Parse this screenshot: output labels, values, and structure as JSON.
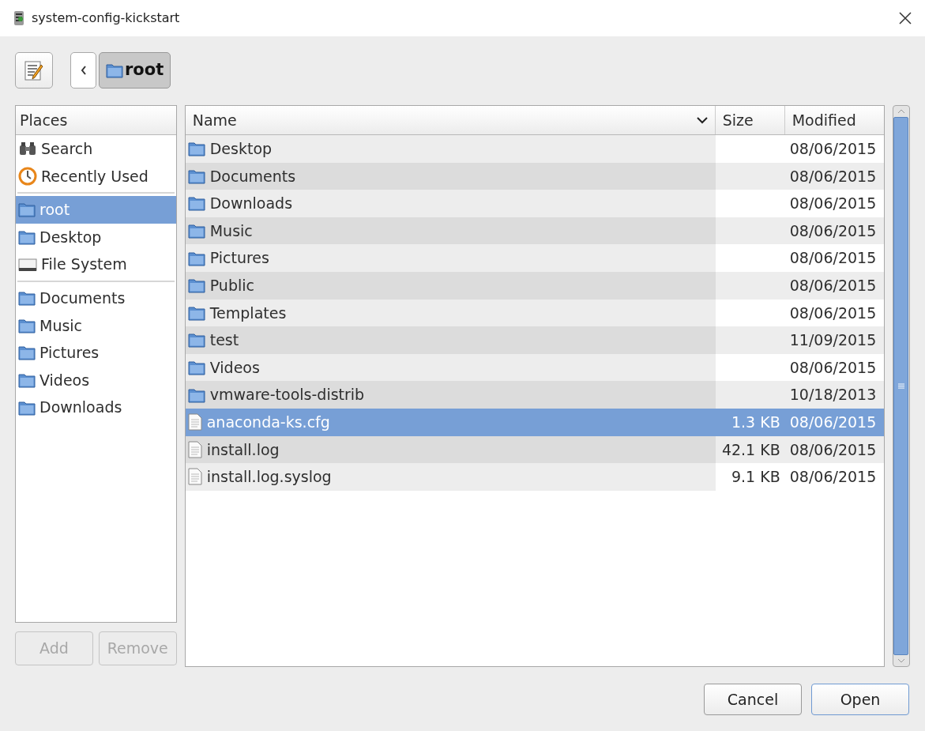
{
  "window": {
    "title": "system-config-kickstart"
  },
  "path_bar": {
    "segments": [
      {
        "label": "root",
        "selected": true
      }
    ]
  },
  "places": {
    "heading": "Places",
    "sections": [
      [
        {
          "label": "Search",
          "kind": "search",
          "selected": false
        },
        {
          "label": "Recently Used",
          "kind": "recent",
          "selected": false
        }
      ],
      [
        {
          "label": "root",
          "kind": "folder",
          "selected": true
        },
        {
          "label": "Desktop",
          "kind": "folder",
          "selected": false
        },
        {
          "label": "File System",
          "kind": "drive",
          "selected": false
        }
      ],
      [
        {
          "label": "Documents",
          "kind": "folder",
          "selected": false
        },
        {
          "label": "Music",
          "kind": "folder",
          "selected": false
        },
        {
          "label": "Pictures",
          "kind": "folder",
          "selected": false
        },
        {
          "label": "Videos",
          "kind": "folder",
          "selected": false
        },
        {
          "label": "Downloads",
          "kind": "folder",
          "selected": false
        }
      ]
    ],
    "buttons": [
      {
        "label": "Add",
        "disabled": true
      },
      {
        "label": "Remove",
        "disabled": true
      }
    ]
  },
  "files": {
    "columns": [
      "Name",
      "Size",
      "Modified"
    ],
    "rows": [
      {
        "name": "Desktop",
        "kind": "folder",
        "size": "",
        "modified": "08/06/2015",
        "selected": false
      },
      {
        "name": "Documents",
        "kind": "folder",
        "size": "",
        "modified": "08/06/2015",
        "selected": false
      },
      {
        "name": "Downloads",
        "kind": "folder",
        "size": "",
        "modified": "08/06/2015",
        "selected": false
      },
      {
        "name": "Music",
        "kind": "folder",
        "size": "",
        "modified": "08/06/2015",
        "selected": false
      },
      {
        "name": "Pictures",
        "kind": "folder",
        "size": "",
        "modified": "08/06/2015",
        "selected": false
      },
      {
        "name": "Public",
        "kind": "folder",
        "size": "",
        "modified": "08/06/2015",
        "selected": false
      },
      {
        "name": "Templates",
        "kind": "folder",
        "size": "",
        "modified": "08/06/2015",
        "selected": false
      },
      {
        "name": "test",
        "kind": "folder",
        "size": "",
        "modified": "11/09/2015",
        "selected": false
      },
      {
        "name": "Videos",
        "kind": "folder",
        "size": "",
        "modified": "08/06/2015",
        "selected": false
      },
      {
        "name": "vmware-tools-distrib",
        "kind": "folder",
        "size": "",
        "modified": "10/18/2013",
        "selected": false
      },
      {
        "name": "anaconda-ks.cfg",
        "kind": "file",
        "size": "1.3 KB",
        "modified": "08/06/2015",
        "selected": true
      },
      {
        "name": "install.log",
        "kind": "file",
        "size": "42.1 KB",
        "modified": "08/06/2015",
        "selected": false
      },
      {
        "name": "install.log.syslog",
        "kind": "file",
        "size": "9.1 KB",
        "modified": "08/06/2015",
        "selected": false
      }
    ]
  },
  "dialog_buttons": [
    "Cancel",
    "Open"
  ]
}
